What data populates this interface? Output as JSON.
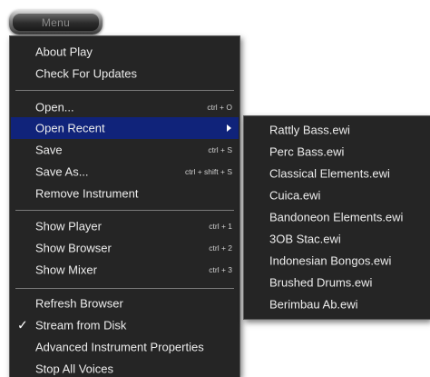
{
  "menu_button": {
    "label": "Menu"
  },
  "main_menu": {
    "about": {
      "label": "About Play"
    },
    "updates": {
      "label": "Check For Updates"
    },
    "open": {
      "label": "Open...",
      "shortcut": "ctrl + O"
    },
    "open_recent": {
      "label": "Open Recent"
    },
    "save": {
      "label": "Save",
      "shortcut": "ctrl + S"
    },
    "save_as": {
      "label": "Save As...",
      "shortcut": "ctrl + shift + S"
    },
    "remove_instrument": {
      "label": "Remove Instrument"
    },
    "show_player": {
      "label": "Show Player",
      "shortcut": "ctrl + 1"
    },
    "show_browser": {
      "label": "Show Browser",
      "shortcut": "ctrl + 2"
    },
    "show_mixer": {
      "label": "Show Mixer",
      "shortcut": "ctrl + 3"
    },
    "refresh_browser": {
      "label": "Refresh Browser"
    },
    "stream_from_disk": {
      "label": "Stream from Disk",
      "checked": true,
      "check_glyph": "✓"
    },
    "advanced_properties": {
      "label": "Advanced Instrument Properties"
    },
    "stop_all_voices": {
      "label": "Stop All Voices"
    }
  },
  "recent_files": [
    {
      "label": "Rattly Bass.ewi"
    },
    {
      "label": "Perc Bass.ewi"
    },
    {
      "label": "Classical Elements.ewi"
    },
    {
      "label": "Cuica.ewi"
    },
    {
      "label": "Bandoneon Elements.ewi"
    },
    {
      "label": "3OB Stac.ewi"
    },
    {
      "label": "Indonesian Bongos.ewi"
    },
    {
      "label": "Brushed Drums.ewi"
    },
    {
      "label": "Berimbau Ab.ewi"
    }
  ],
  "colors": {
    "menu_background": "#252525",
    "highlight": "#10237a",
    "text": "#ececec",
    "separator": "#7a7a7a"
  }
}
